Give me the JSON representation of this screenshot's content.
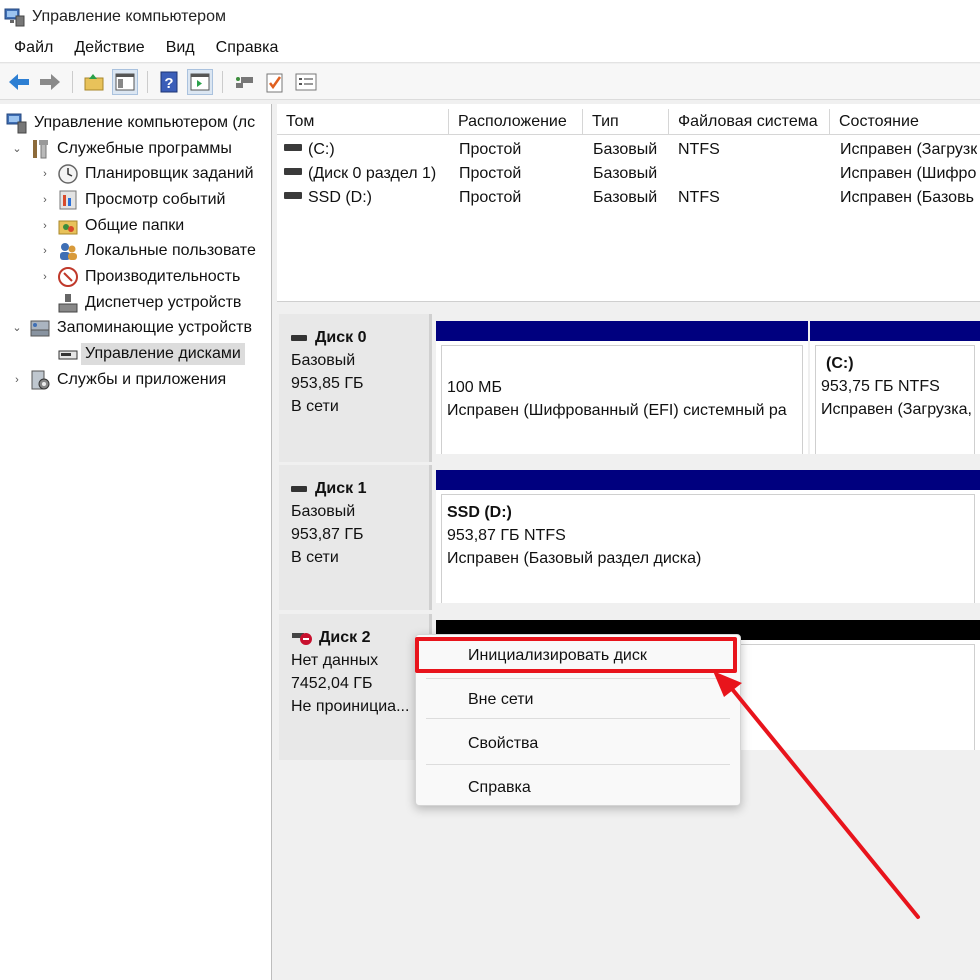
{
  "window": {
    "title": "Управление компьютером"
  },
  "menu": [
    "Файл",
    "Действие",
    "Вид",
    "Справка"
  ],
  "toolbar": [
    "back-icon",
    "forward-icon",
    "up-folder-icon",
    "show-hide-tree-icon",
    "help-icon",
    "show-hide-action-pane-icon",
    "connect-icon",
    "check-icon",
    "properties-icon"
  ],
  "tree": {
    "root": "Управление компьютером (лс",
    "system_tools": "Служебные программы",
    "task_scheduler": "Планировщик заданий",
    "event_viewer": "Просмотр событий",
    "shared_folders": "Общие папки",
    "local_users": "Локальные пользовате",
    "performance": "Производительность",
    "device_manager": "Диспетчер устройств",
    "storage": "Запоминающие устройств",
    "disk_management": "Управление дисками",
    "services": "Службы и приложения"
  },
  "volumes": {
    "columns": [
      "Том",
      "Расположение",
      "Тип",
      "Файловая система",
      "Состояние"
    ],
    "rows": [
      [
        "(C:)",
        "Простой",
        "Базовый",
        "NTFS",
        "Исправен (Загрузк"
      ],
      [
        "(Диск 0 раздел 1)",
        "Простой",
        "Базовый",
        "",
        "Исправен (Шифро"
      ],
      [
        "SSD (D:)",
        "Простой",
        "Базовый",
        "NTFS",
        "Исправен (Базовь"
      ]
    ]
  },
  "disks": {
    "disk0": {
      "name": "Диск 0",
      "type": "Базовый",
      "size": "953,85 ГБ",
      "status": "В сети",
      "part1": {
        "size": "100 МБ",
        "status": "Исправен (Шифрованный (EFI) системный ра"
      },
      "part2": {
        "label": "(C:)",
        "size": "953,75 ГБ NTFS",
        "status": "Исправен (Загрузка,"
      }
    },
    "disk1": {
      "name": "Диск 1",
      "type": "Базовый",
      "size": "953,87 ГБ",
      "status": "В сети",
      "part1": {
        "label": "SSD  (D:)",
        "size": "953,87 ГБ NTFS",
        "status": "Исправен (Базовый раздел диска)"
      }
    },
    "disk2": {
      "name": "Диск 2",
      "type": "Нет данных",
      "size": "7452,04 ГБ",
      "status": "Не проинициа..."
    }
  },
  "context_menu": {
    "initialize": "Инициализировать диск",
    "offline": "Вне сети",
    "properties": "Свойства",
    "help": "Справка"
  },
  "colors": {
    "partition_bar": "#00007f",
    "unallocated_bar": "#000000",
    "highlight": "#e8141c"
  }
}
